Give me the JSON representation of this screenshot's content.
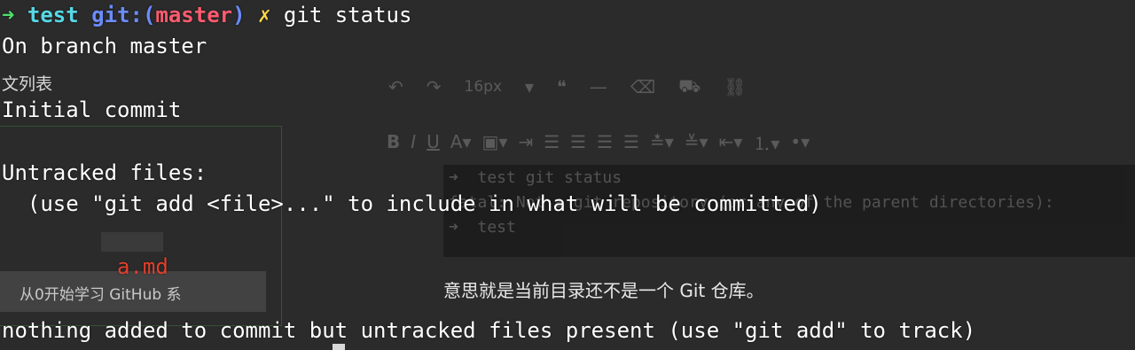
{
  "background": {
    "sidebar_lines": [
      "文列表"
    ],
    "sidebar_card_text": "从0开始学习 GitHub 系",
    "toolbar_row1": {
      "undo_icon": "undo-icon",
      "redo_icon": "redo-icon",
      "font_size": "16px",
      "quote_icon": "quote-icon",
      "hr_icon": "horizontal-rule-icon",
      "eraser_icon": "eraser-icon",
      "paint_icon": "paint-bucket-icon",
      "link_icon": "link-icon"
    },
    "embedded_terminal": {
      "line1": "➜  test git status",
      "line2": "fatal: Not a git repository (or any of the parent directories):",
      "line3": "➜  test"
    },
    "caption": "意思就是当前目录还不是一个 Git 仓库。"
  },
  "terminal": {
    "prompt": {
      "arrow": "➜",
      "dir": "test",
      "git_prefix": "git:(",
      "branch": "master",
      "git_suffix": ")",
      "dirty_mark": "✗",
      "command": "git status"
    },
    "lines": {
      "branch_line": "On branch master",
      "initial_commit": "Initial commit",
      "untracked_header": "Untracked files:",
      "hint": "  (use \"git add <file>...\" to include in what will be committed)",
      "file": "a.md",
      "summary": "nothing added to commit but untracked files present (use \"git add\" to track)"
    }
  },
  "colors": {
    "arrow": "#4ee06a",
    "dir": "#57d8e6",
    "git": "#6c8cff",
    "branch": "#ff5b6e",
    "dirty": "#ffd84a",
    "untracked": "#e0402c"
  }
}
